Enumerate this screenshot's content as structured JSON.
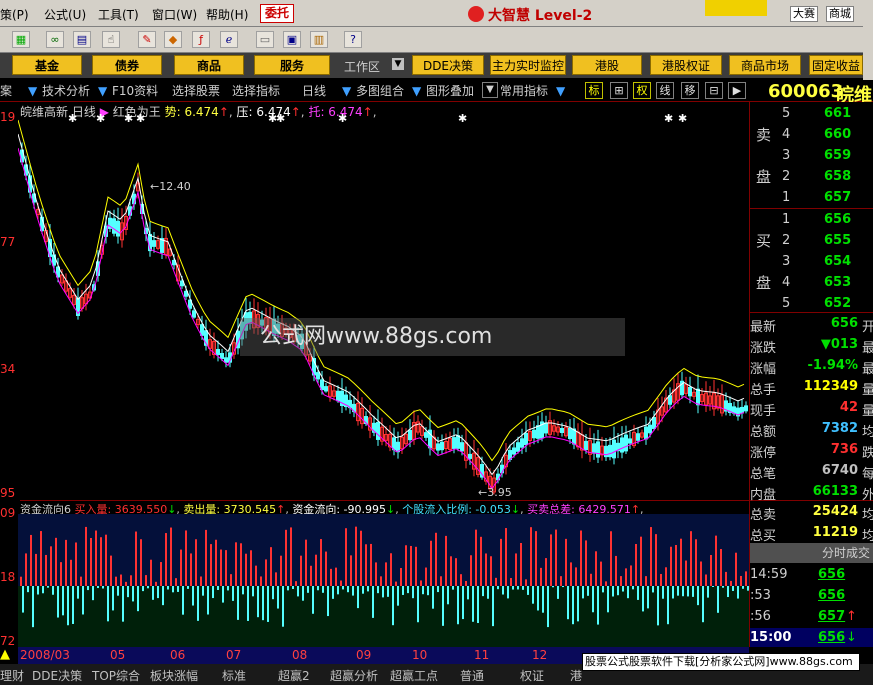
{
  "menubar": {
    "items": [
      "策(P)",
      "公式(U)",
      "工具(T)",
      "窗口(W)",
      "帮助(H)"
    ],
    "entrust": "委托",
    "brand": "大智慧 Level-2",
    "right_items": [
      "大赛",
      "商城"
    ]
  },
  "navbar": {
    "buttons": [
      "基金",
      "债券",
      "商品",
      "服务"
    ],
    "workspace": "工作区",
    "right_buttons": [
      "DDE决策",
      "主力实时监控",
      "港股",
      "港股权证",
      "商品市场",
      "固定收益"
    ]
  },
  "tabbar": {
    "tabs": [
      "案",
      "技术分析",
      "F10资料",
      "选择股票",
      "选择指标",
      "日线",
      "多图组合",
      "图形叠加",
      "常用指标"
    ],
    "squares": [
      "标",
      "田",
      "权",
      "线",
      "移"
    ],
    "stock_code": "600063",
    "stock_name": "皖维"
  },
  "main_chart": {
    "header": {
      "name": "皖维高新",
      "period": "日线",
      "indicator": "红色为王",
      "shi": "势: 6.474",
      "ya": "压: 6.474",
      "tuo": "托: 6.474"
    },
    "y_labels": [
      "19",
      "77",
      "34",
      "95"
    ],
    "high_label": "12.40",
    "low_label": "3.95",
    "watermark": "公式网www.88gs.com"
  },
  "lower_chart": {
    "name": "资金流向6",
    "buy": "买入量: 3639.550",
    "sell": "卖出量: 3730.545",
    "flow": "资金流向: -90.995",
    "ratio": "个股流入比例: -0.053",
    "diff": "买卖总差: 6429.571",
    "y_labels": [
      "09",
      "18",
      "72"
    ],
    "x_labels": [
      "2008/03",
      "05",
      "06",
      "07",
      "08",
      "09",
      "10",
      "11",
      "12"
    ]
  },
  "order_book": {
    "sell_label": [
      "卖",
      "盘"
    ],
    "buy_label": [
      "买",
      "盘"
    ],
    "sell": [
      {
        "level": "5",
        "price": "661"
      },
      {
        "level": "4",
        "price": "660"
      },
      {
        "level": "3",
        "price": "659"
      },
      {
        "level": "2",
        "price": "658"
      },
      {
        "level": "1",
        "price": "657"
      }
    ],
    "buy": [
      {
        "level": "1",
        "price": "656"
      },
      {
        "level": "2",
        "price": "655"
      },
      {
        "level": "3",
        "price": "654"
      },
      {
        "level": "4",
        "price": "653"
      },
      {
        "level": "5",
        "price": "652"
      }
    ]
  },
  "quote": [
    {
      "label": "最新",
      "value": "656",
      "tail": "开",
      "color": "#00e000"
    },
    {
      "label": "涨跌",
      "value": "▼013",
      "tail": "最",
      "color": "#00e000"
    },
    {
      "label": "涨幅",
      "value": "-1.94%",
      "tail": "最",
      "color": "#00e000"
    },
    {
      "label": "总手",
      "value": "112349",
      "tail": "量",
      "color": "#ffff00"
    },
    {
      "label": "现手",
      "value": "42",
      "tail": "量",
      "color": "#ff3030"
    },
    {
      "label": "总额",
      "value": "7382",
      "tail": "均",
      "color": "#40c0ff"
    },
    {
      "label": "涨停",
      "value": "736",
      "tail": "跌",
      "color": "#ff3030"
    },
    {
      "label": "总笔",
      "value": "6740",
      "tail": "每",
      "color": "#c0c0c0"
    },
    {
      "label": "内盘",
      "value": "66133",
      "tail": "外",
      "color": "#00e000"
    }
  ],
  "totals": [
    {
      "label": "总卖",
      "value": "25424",
      "tail": "均"
    },
    {
      "label": "总买",
      "value": "11219",
      "tail": "均"
    }
  ],
  "ticks_header": "分时成交",
  "ticks": [
    {
      "time": "14:59",
      "price": "656",
      "arrow": ""
    },
    {
      "time": ":53",
      "price": "656",
      "arrow": ""
    },
    {
      "time": ":56",
      "price": "657",
      "arrow": "↑"
    },
    {
      "time": "15:00",
      "price": "656",
      "arrow": "↓"
    }
  ],
  "bottom_tabs": [
    "理财",
    "DDE决策",
    "TOP综合",
    "板块涨幅",
    "标准",
    "超赢2",
    "超赢分析",
    "超赢工点",
    "普通",
    "权证",
    "港"
  ],
  "footer_ad": "股票公式股票软件下载[分析家公式网]www.88gs.com",
  "colors": {
    "up": "#ff3232",
    "down": "#54ffff",
    "ma1": "#ffff00",
    "ma2": "#ffffff",
    "ma3": "#ff00ff"
  }
}
